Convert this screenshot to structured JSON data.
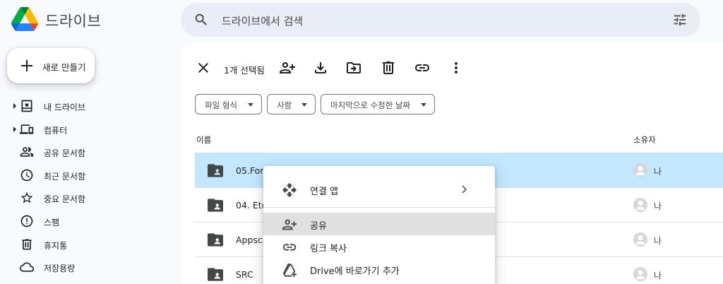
{
  "header": {
    "app_title": "드라이브",
    "search_placeholder": "드라이브에서 검색"
  },
  "new_button": {
    "label": "새로 만들기"
  },
  "sidebar": {
    "items": [
      {
        "label": "내 드라이브",
        "icon": "my-drive-icon",
        "expandable": true
      },
      {
        "label": "컴퓨터",
        "icon": "computers-icon",
        "expandable": true
      },
      {
        "label": "공유 문서함",
        "icon": "shared-icon",
        "expandable": false
      },
      {
        "label": "최근 문서함",
        "icon": "clock-icon",
        "expandable": false
      },
      {
        "label": "중요 문서함",
        "icon": "star-icon",
        "expandable": false
      },
      {
        "label": "스팸",
        "icon": "spam-icon",
        "expandable": false
      },
      {
        "label": "휴지통",
        "icon": "trash-icon",
        "expandable": false
      },
      {
        "label": "저장용량",
        "icon": "cloud-icon",
        "expandable": false
      }
    ]
  },
  "toolbar": {
    "selection_count": "1개 선택됨"
  },
  "filters": {
    "type": "파일 형식",
    "people": "사람",
    "modified": "마지막으로 수정한 날짜"
  },
  "columns": {
    "name": "이름",
    "owner": "소유자"
  },
  "files": [
    {
      "name": "05.For",
      "owner": "나",
      "selected": true
    },
    {
      "name": "04. Etc",
      "owner": "나",
      "selected": false
    },
    {
      "name": "Appscr",
      "owner": "나",
      "selected": false
    },
    {
      "name": "SRC",
      "owner": "나",
      "selected": false
    }
  ],
  "context_menu": {
    "items": [
      {
        "label": "연결 앱",
        "icon": "open-with-icon"
      },
      {
        "label": "공유",
        "icon": "share-icon"
      },
      {
        "label": "링크 복사",
        "icon": "link-icon"
      },
      {
        "label": "Drive에 바로가기 추가",
        "icon": "add-shortcut-icon"
      }
    ]
  },
  "colors": {
    "selected_row": "#c2e7ff",
    "search_bg": "#e9eef6",
    "page_bg": "#f8fafd"
  }
}
